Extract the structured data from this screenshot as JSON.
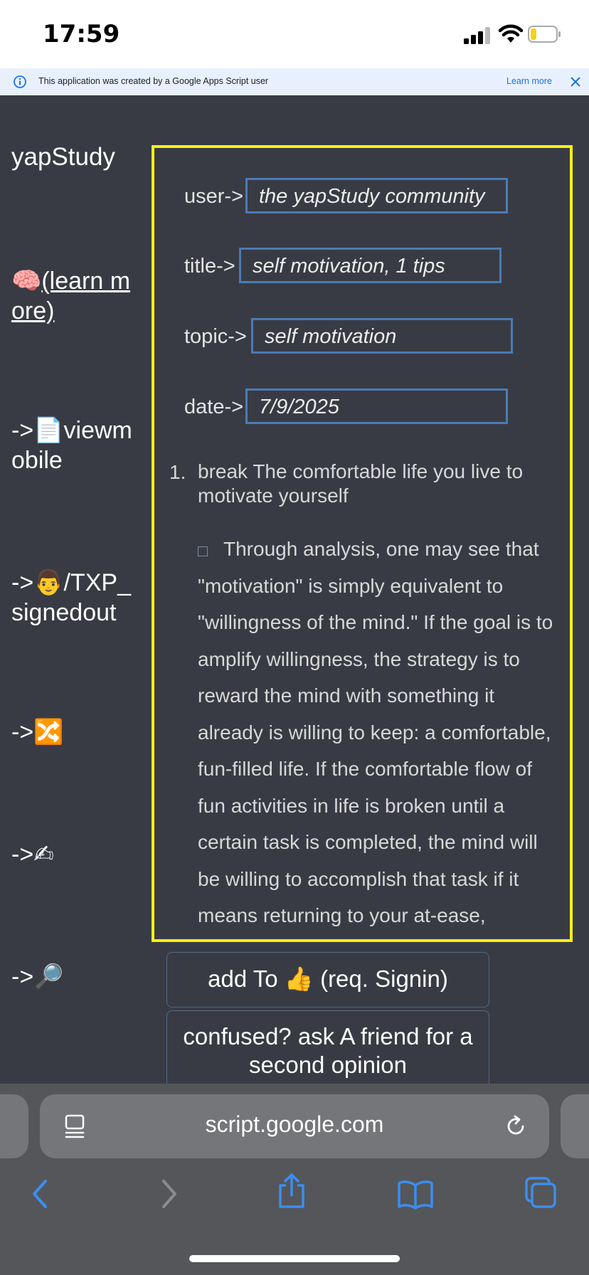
{
  "status_bar": {
    "time": "17:59"
  },
  "banner": {
    "text": "This application was created by a Google Apps Script user",
    "link": "Learn more"
  },
  "sidebar": {
    "brand": "yapStudy",
    "items": [
      {
        "emoji": "🧠",
        "label": "(learn more)"
      },
      {
        "prefix": "->",
        "emoji": "📄",
        "label": "viewmobile"
      },
      {
        "prefix": "->",
        "emoji": "👨",
        "label": "/TXP_signedout"
      },
      {
        "prefix": "->",
        "emoji": "🔀",
        "label": ""
      },
      {
        "prefix": "->",
        "emoji": "✍",
        "label": ""
      },
      {
        "prefix": "->",
        "emoji": "🔎",
        "label": ""
      }
    ]
  },
  "form": {
    "user_label": "user->",
    "user_value": "the yapStudy community",
    "title_label": "title->",
    "title_value": "self motivation, 1 tips",
    "topic_label": "topic->",
    "topic_value": "self motivation",
    "date_label": "date->",
    "date_value": "7/9/2025"
  },
  "tips": [
    {
      "number": "1.",
      "title": "break The comfortable life you live to motivate yourself",
      "body": "Through analysis, one may see that \"motivation\" is simply equivalent to \"willingness of the mind.\" If the goal is to amplify willingness, the strategy is to reward the mind with something it already is willing to keep: a comfortable, fun-filled life. If the comfortable flow of fun activities in life is broken until a certain task is completed, the mind will be willing to accomplish that task if it means returning to your at-ease, enjoyable"
    }
  ],
  "buttons": {
    "add": "add To 👍 (req. Signin)",
    "ask": "confused? ask A friend for a second opinion"
  },
  "browser": {
    "url": "script.google.com"
  },
  "colors": {
    "panel_border": "#f5f016",
    "field_border": "#4a7bb5",
    "background": "#393b44",
    "link": "#1a73e8"
  }
}
